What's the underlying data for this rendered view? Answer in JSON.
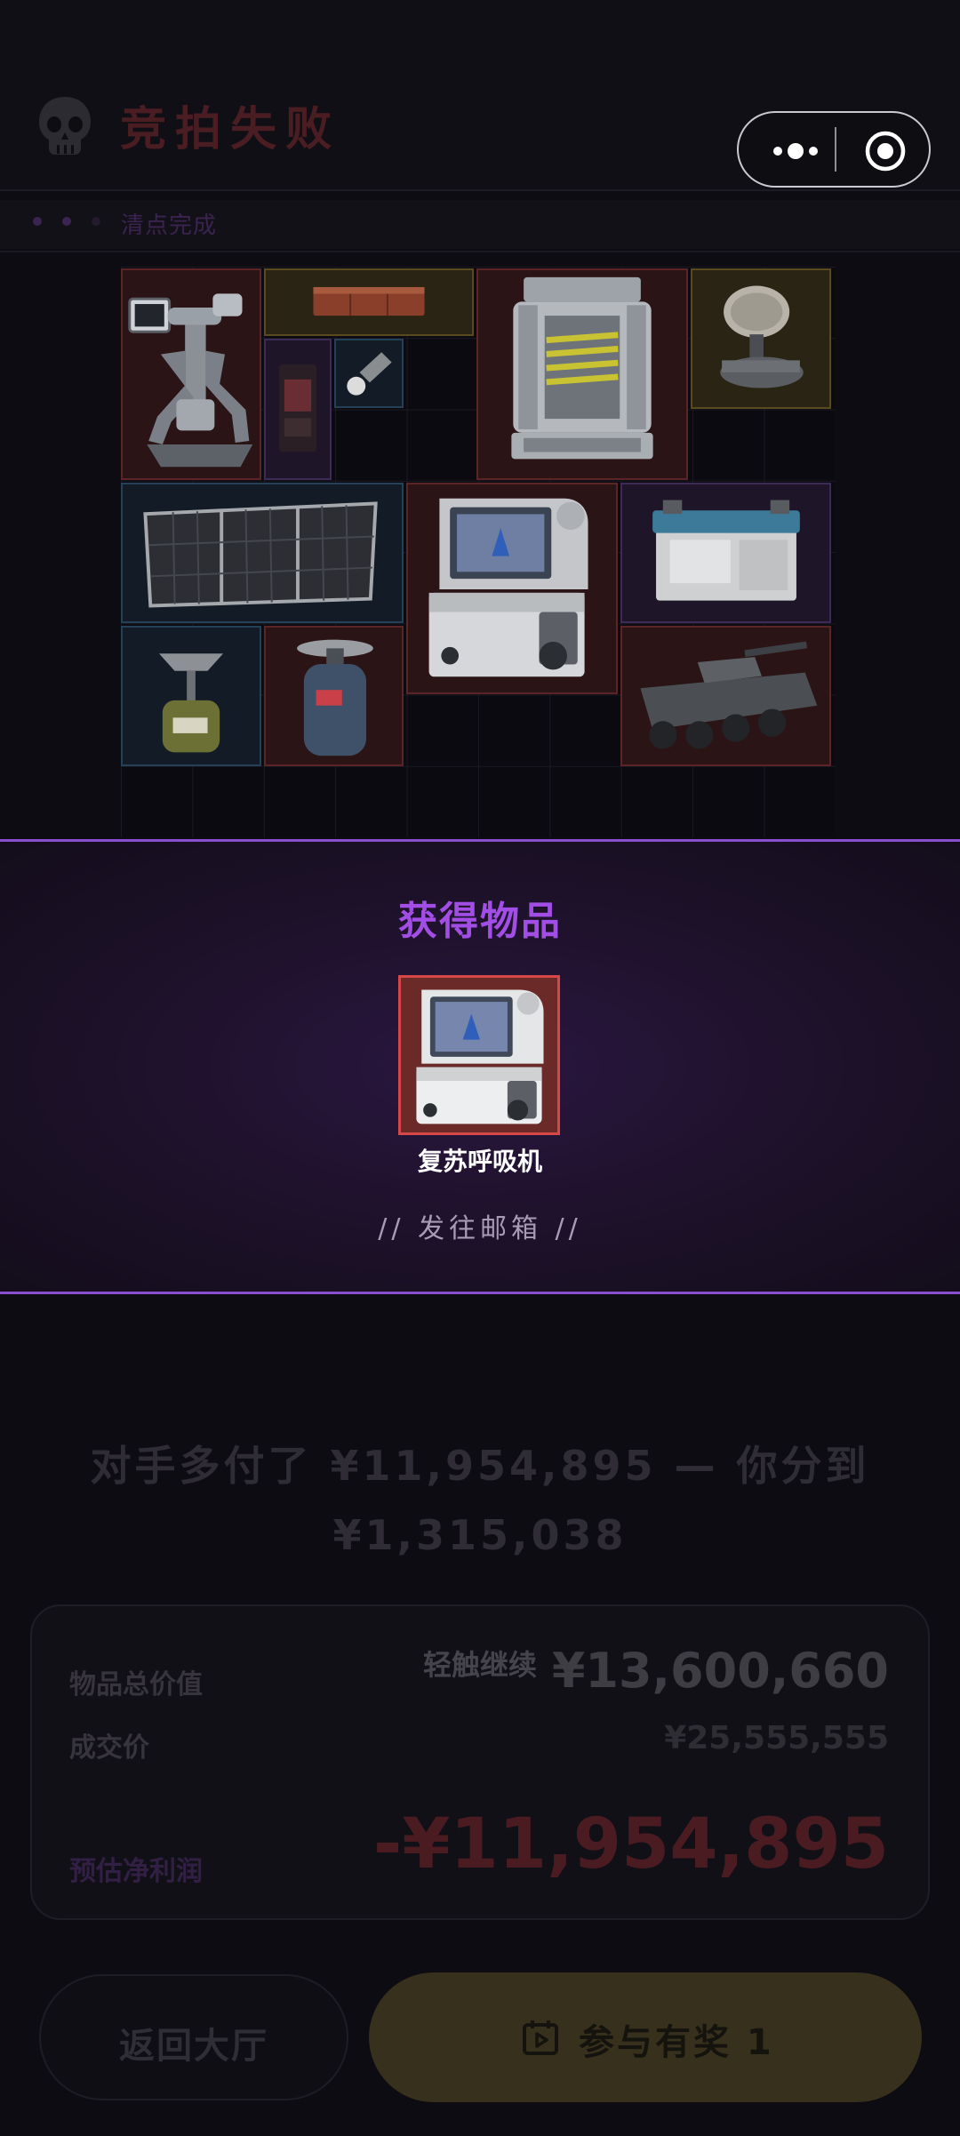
{
  "header": {
    "title": "竞拍失败"
  },
  "progress": {
    "label": "清点完成"
  },
  "stash_items": [
    {
      "name": "robot-turret",
      "rarity": "red"
    },
    {
      "name": "brick-stack",
      "rarity": "yellow"
    },
    {
      "name": "vault-reactor",
      "rarity": "red"
    },
    {
      "name": "satellite-dish",
      "rarity": "yellow"
    },
    {
      "name": "snack-pack",
      "rarity": "purple"
    },
    {
      "name": "shuttlecock",
      "rarity": "blue"
    },
    {
      "name": "solar-panel",
      "rarity": "blue"
    },
    {
      "name": "ventilator",
      "rarity": "red"
    },
    {
      "name": "car-battery",
      "rarity": "purple"
    },
    {
      "name": "camping-stove",
      "rarity": "blue"
    },
    {
      "name": "gas-canister",
      "rarity": "red"
    },
    {
      "name": "armored-vehicle",
      "rarity": "red"
    }
  ],
  "reward": {
    "title": "获得物品",
    "item_name": "复苏呼吸机",
    "note": "// 发往邮箱 //"
  },
  "summary": {
    "line1": "对手多付了 ¥11,954,895 — 你分到",
    "line2": "¥1,315,038"
  },
  "stats": {
    "tap_hint": "轻触继续",
    "total_value_label": "物品总价值",
    "total_value": "¥13,600,660",
    "deal_price_label": "成交价",
    "deal_price": "¥25,555,555",
    "profit_label": "预估净利润",
    "profit": "-¥11,954,895"
  },
  "buttons": {
    "back": "返回大厅",
    "join": "参与有奖 1"
  },
  "colors": {
    "accent_purple": "#a24ee6",
    "loss_red": "#4a1d22",
    "gold_button": "#37301c"
  }
}
